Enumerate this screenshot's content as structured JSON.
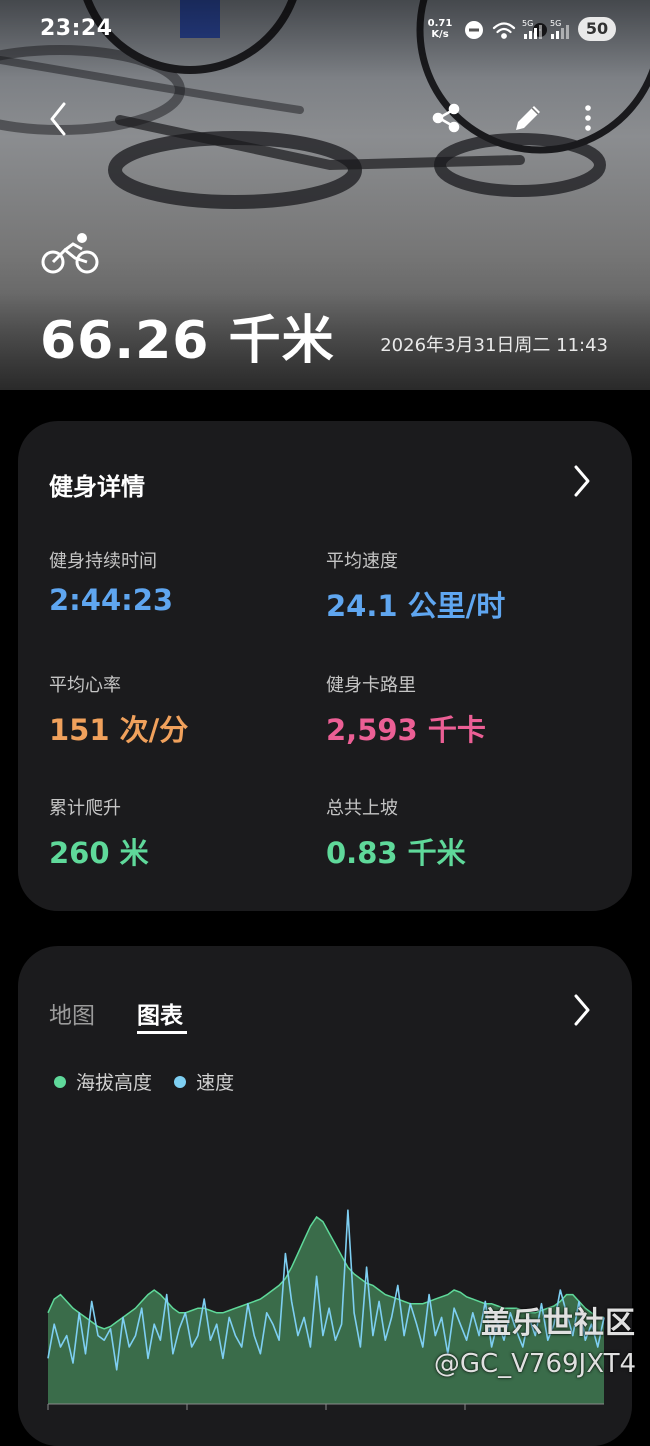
{
  "status_bar": {
    "time": "23:24",
    "net_speed_value": "0.71",
    "net_speed_unit": "K/s",
    "battery": "50",
    "signal_labels": [
      "5G",
      "5G"
    ]
  },
  "workout": {
    "distance": "66.26 千米",
    "datetime": "2026年3月31日周二 11:43",
    "activity_icon": "cycling-icon"
  },
  "details": {
    "title": "健身详情",
    "stats": [
      {
        "label": "健身持续时间",
        "value": "2:44:23",
        "color": "#5fa6f0"
      },
      {
        "label": "平均速度",
        "value": "24.1 公里/时",
        "color": "#5fa6f0"
      },
      {
        "label": "平均心率",
        "value": "151 次/分",
        "color": "#f0a15c"
      },
      {
        "label": "健身卡路里",
        "value": "2,593 千卡",
        "color": "#ec5f95"
      },
      {
        "label": "累计爬升",
        "value": "260 米",
        "color": "#5fd99a"
      },
      {
        "label": "总共上坡",
        "value": "0.83 千米",
        "color": "#5fd99a"
      }
    ]
  },
  "chart_section": {
    "tabs": [
      {
        "label": "地图",
        "active": false
      },
      {
        "label": "图表",
        "active": true
      }
    ],
    "legend": [
      {
        "label": "海拔高度",
        "color": "#5fd99a"
      },
      {
        "label": "速度",
        "color": "#7ecff2"
      }
    ]
  },
  "chart_data": {
    "type": "area",
    "title": "",
    "xlabel": "",
    "ylabel": "",
    "grid": false,
    "series": [
      {
        "name": "海拔高度",
        "color": "#4a8a5c",
        "values": [
          40,
          46,
          48,
          45,
          42,
          40,
          38,
          36,
          34,
          33,
          34,
          36,
          38,
          40,
          42,
          45,
          48,
          50,
          48,
          45,
          42,
          40,
          40,
          41,
          42,
          42,
          41,
          40,
          40,
          41,
          42,
          43,
          44,
          45,
          46,
          48,
          50,
          52,
          55,
          60,
          66,
          72,
          78,
          82,
          80,
          75,
          70,
          65,
          60,
          57,
          55,
          53,
          52,
          50,
          48,
          47,
          46,
          45,
          44,
          44,
          44,
          45,
          46,
          47,
          48,
          50,
          49,
          47,
          46,
          45,
          44,
          44,
          43,
          42,
          42,
          42,
          41,
          40,
          40,
          41,
          42,
          43,
          45,
          48,
          48,
          45,
          42,
          40,
          38,
          38
        ]
      },
      {
        "name": "速度",
        "color": "#7ecff2",
        "values": [
          20,
          35,
          25,
          30,
          18,
          40,
          22,
          45,
          30,
          28,
          33,
          15,
          38,
          25,
          30,
          42,
          20,
          35,
          28,
          48,
          22,
          33,
          40,
          25,
          30,
          46,
          28,
          35,
          20,
          38,
          30,
          25,
          44,
          30,
          22,
          40,
          35,
          28,
          66,
          45,
          30,
          38,
          25,
          56,
          30,
          42,
          28,
          35,
          85,
          40,
          25,
          60,
          30,
          45,
          28,
          38,
          52,
          30,
          44,
          35,
          25,
          48,
          30,
          38,
          22,
          42,
          35,
          28,
          40,
          30,
          45,
          25,
          36,
          28,
          40,
          32,
          25,
          38,
          30,
          44,
          28,
          35,
          50,
          40,
          30,
          45,
          28,
          35,
          25,
          38
        ]
      }
    ]
  },
  "watermark": {
    "site": "盖乐世社区",
    "user": "@GC_V769JXT4"
  }
}
